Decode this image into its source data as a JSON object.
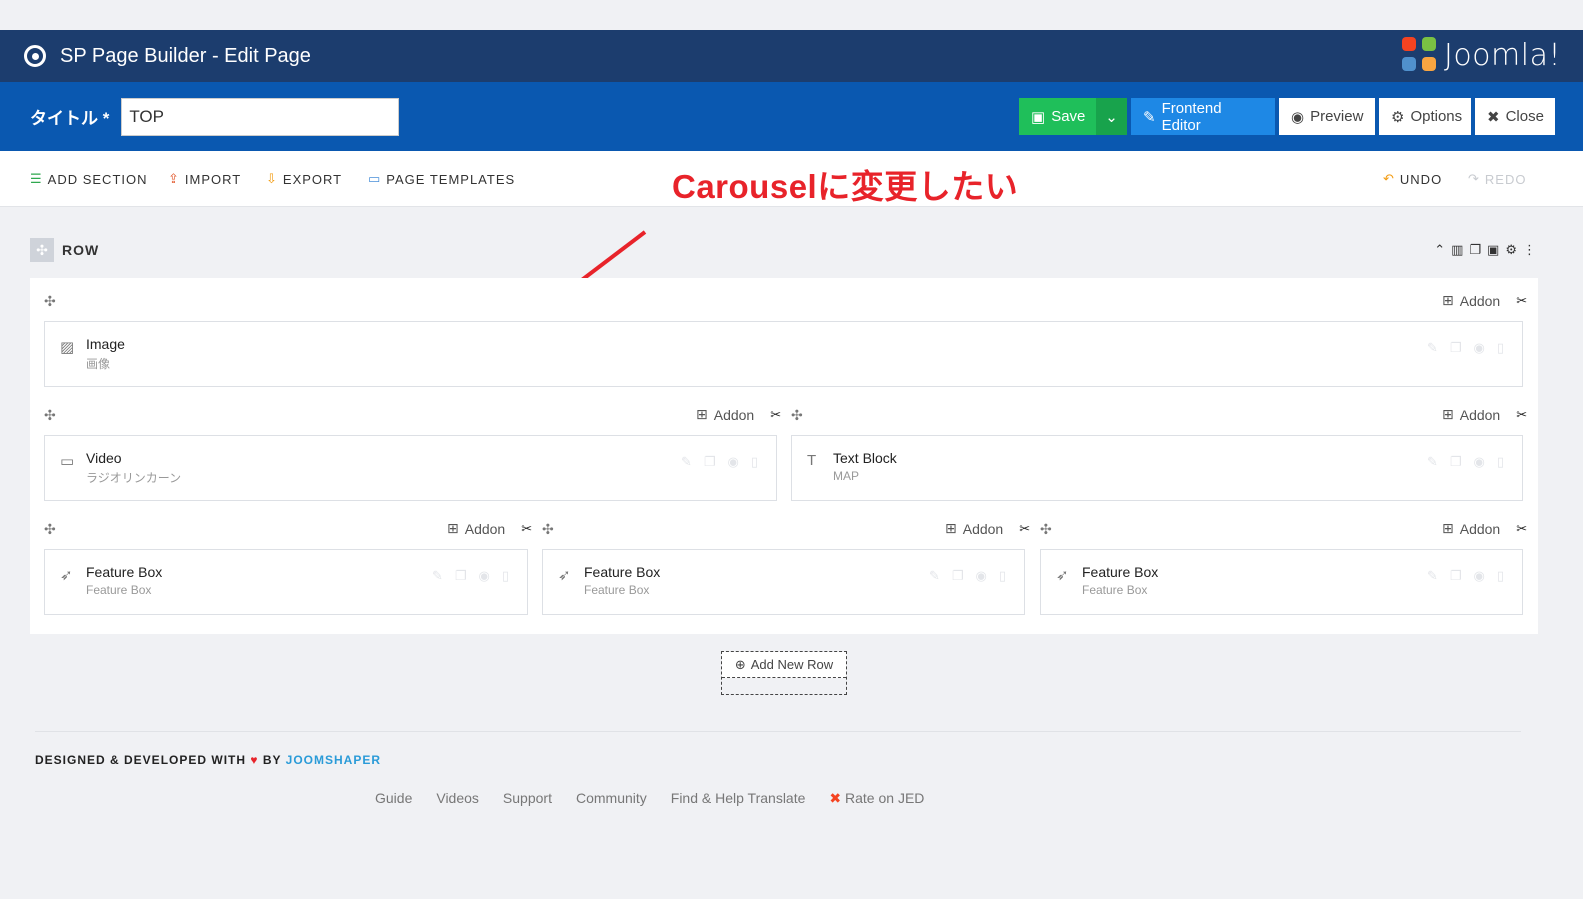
{
  "app": {
    "title": "SP Page Builder - Edit Page",
    "brand": "Joomla!"
  },
  "toolbar": {
    "title_label": "タイトル *",
    "title_value": "TOP",
    "save_label": "Save",
    "frontend_label": "Frontend Editor",
    "preview_label": "Preview",
    "options_label": "Options",
    "close_label": "Close"
  },
  "menu": {
    "add_section": "ADD SECTION",
    "import": "IMPORT",
    "export": "EXPORT",
    "page_templates": "PAGE TEMPLATES",
    "undo": "UNDO",
    "redo": "REDO"
  },
  "annotation": "Carouselに変更したい",
  "row": {
    "label": "ROW"
  },
  "addon_label": "Addon",
  "addons": {
    "image": {
      "title": "Image",
      "subtitle": "画像"
    },
    "video": {
      "title": "Video",
      "subtitle": "ラジオリンカーン"
    },
    "text_block": {
      "title": "Text Block",
      "subtitle": "MAP"
    },
    "feature_1": {
      "title": "Feature Box",
      "subtitle": "Feature Box"
    },
    "feature_2": {
      "title": "Feature Box",
      "subtitle": "Feature Box"
    },
    "feature_3": {
      "title": "Feature Box",
      "subtitle": "Feature Box"
    }
  },
  "add_new_row": "Add New Row",
  "footer": {
    "credit_prefix": "DESIGNED & DEVELOPED WITH",
    "credit_by": "BY",
    "credit_brand": "JOOMSHAPER",
    "links": [
      "Guide",
      "Videos",
      "Support",
      "Community",
      "Find & Help Translate",
      "Rate on JED"
    ]
  },
  "colors": {
    "header": "#1c3d6e",
    "toolbar": "#0a58b0",
    "save": "#1fbf5a",
    "annotation": "#e8232a"
  }
}
